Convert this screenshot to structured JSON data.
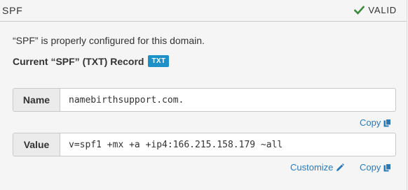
{
  "header": {
    "title": "SPF",
    "status_label": "VALID",
    "status_color": "#3c8b3c"
  },
  "description": "“SPF” is properly configured for this domain.",
  "record": {
    "label": "Current “SPF” (TXT) Record",
    "badge": "TXT"
  },
  "name_field": {
    "label": "Name",
    "value": "namebirthsupport.com."
  },
  "value_field": {
    "label": "Value",
    "value": "v=spf1 +mx +a +ip4:166.215.158.179 ~all"
  },
  "actions": {
    "copy_label": "Copy",
    "customize_label": "Customize",
    "copy_icon": "copy-icon",
    "customize_icon": "pencil-icon"
  },
  "colors": {
    "link": "#2a7ab8",
    "badge": "#1e90c8"
  }
}
